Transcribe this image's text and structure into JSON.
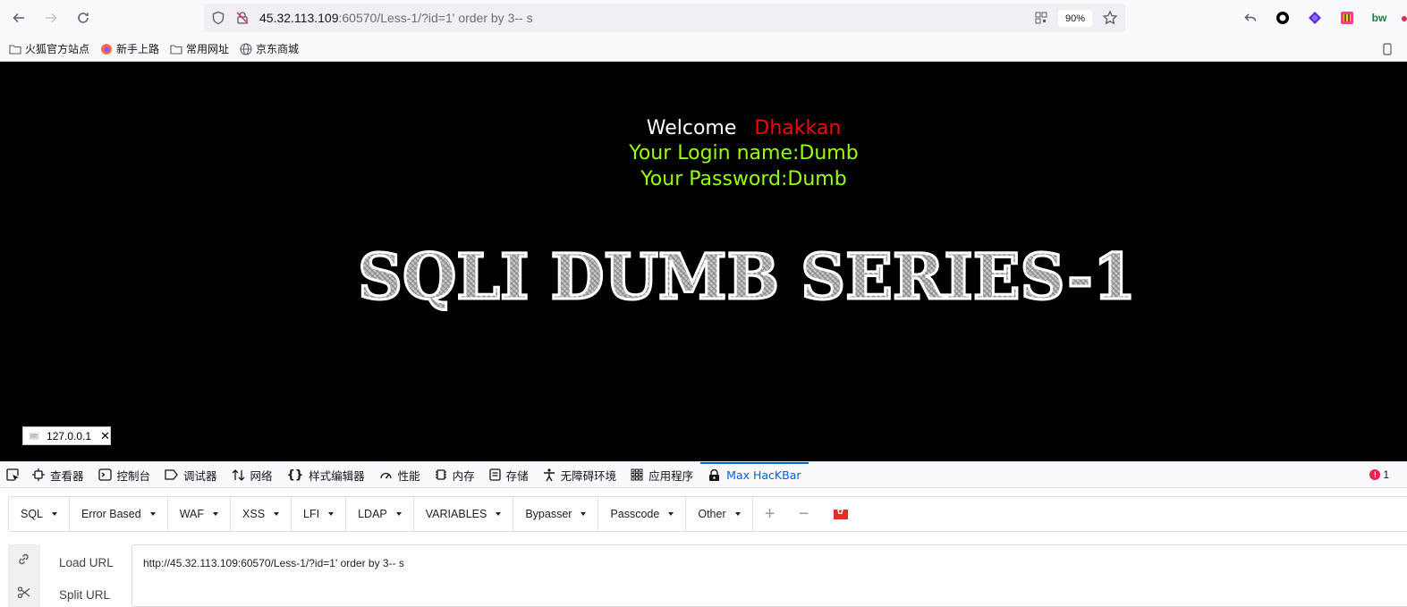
{
  "browser": {
    "url_host": "45.32.113.109",
    "url_rest": ":60570/Less-1/?id=1' order by 3-- s",
    "zoom": "90%"
  },
  "bookmarks": [
    {
      "label": "火狐官方站点",
      "icon": "folder-icon"
    },
    {
      "label": "新手上路",
      "icon": "firefox-icon"
    },
    {
      "label": "常用网址",
      "icon": "folder-icon"
    },
    {
      "label": "京东商城",
      "icon": "globe-icon"
    }
  ],
  "page": {
    "welcome_label": "Welcome",
    "welcome_name": "Dhakkan",
    "login_line": "Your Login name:Dumb",
    "password_line": "Your Password:Dumb",
    "banner_text": "SQLI DUMB SERIES-1",
    "ip_tab_label": "127.0.0.1"
  },
  "devtools": {
    "tabs": [
      {
        "label": "查看器",
        "icon": "inspector-icon"
      },
      {
        "label": "控制台",
        "icon": "console-icon"
      },
      {
        "label": "调试器",
        "icon": "debugger-icon"
      },
      {
        "label": "网络",
        "icon": "network-icon"
      },
      {
        "label": "样式编辑器",
        "icon": "style-editor-icon"
      },
      {
        "label": "性能",
        "icon": "performance-icon"
      },
      {
        "label": "内存",
        "icon": "memory-icon"
      },
      {
        "label": "存储",
        "icon": "storage-icon"
      },
      {
        "label": "无障碍环境",
        "icon": "accessibility-icon"
      },
      {
        "label": "应用程序",
        "icon": "application-icon"
      },
      {
        "label": "Max HacKBar",
        "icon": "hackbar-icon",
        "active": true
      }
    ],
    "error_count": "1"
  },
  "hackbar": {
    "menus": [
      "SQL",
      "Error Based",
      "WAF",
      "XSS",
      "LFI",
      "LDAP",
      "VARIABLES",
      "Bypasser",
      "Passcode",
      "Other"
    ],
    "load_url_label": "Load URL",
    "split_url_label": "Split URL",
    "url_value": "http://45.32.113.109:60570/Less-1/?id=1' order by 3-- s"
  },
  "colors": {
    "welcome_name": "#ff0000",
    "login_text": "#99ff00",
    "active_tab": "#0060df"
  }
}
